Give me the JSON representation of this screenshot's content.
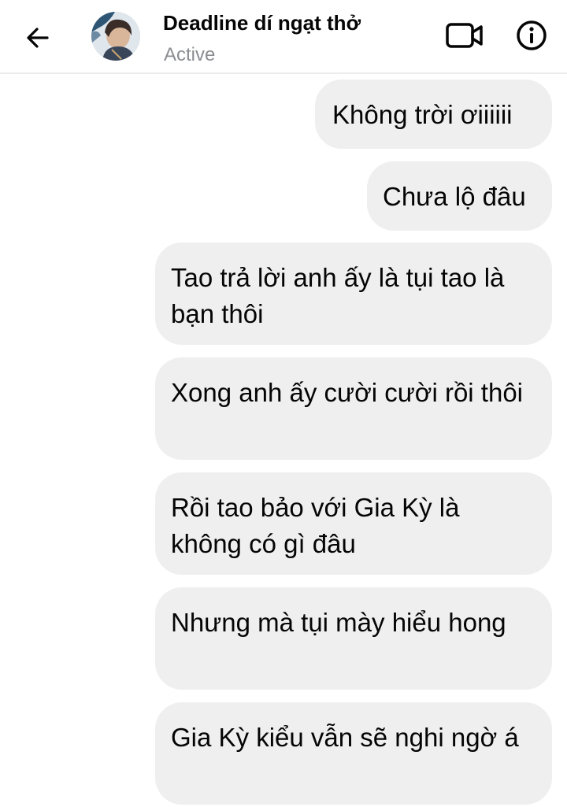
{
  "header": {
    "title": "Deadline dí ngạt thở",
    "status": "Active",
    "back_icon": "arrow-left-icon",
    "video_icon": "video-camera-icon",
    "info_icon": "info-icon"
  },
  "messages": [
    {
      "text": "Không trời ơiiiiii"
    },
    {
      "text": "Chưa lộ đâu"
    },
    {
      "text": "Tao trả lời anh ấy là tụi tao là bạn thôi"
    },
    {
      "text": "Xong anh ấy cười cười rồi thôi"
    },
    {
      "text": "Rồi tao bảo với Gia Kỳ là không có gì đâu"
    },
    {
      "text": "Nhưng mà tụi mày hiểu hong"
    },
    {
      "text": "Gia Kỳ kiểu vẫn sẽ nghi ngờ á"
    }
  ],
  "colors": {
    "bubble_bg": "#efeff0",
    "text": "#050505",
    "subtle_text": "#8a8d91"
  }
}
